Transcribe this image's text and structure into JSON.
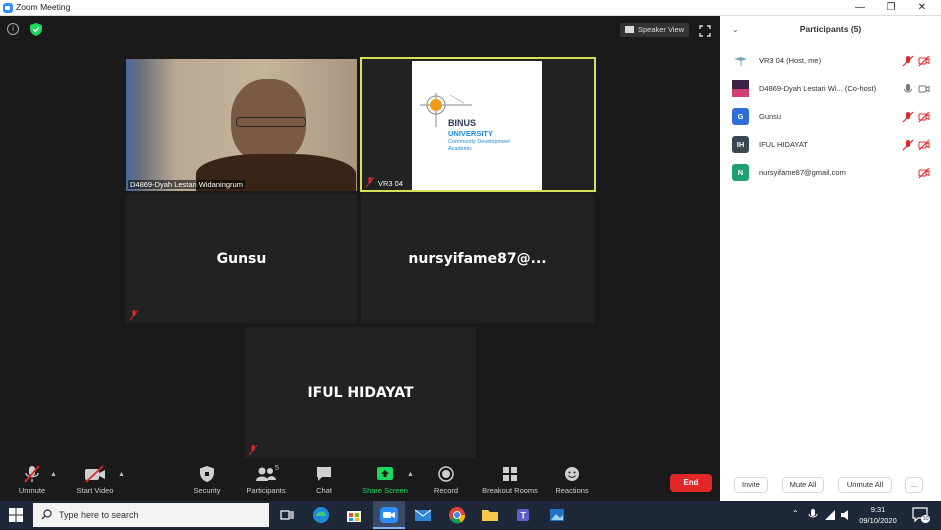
{
  "window": {
    "title": "Zoom Meeting"
  },
  "meeting": {
    "view_label": "Speaker View",
    "tiles": [
      {
        "name_label": "D4869-Dyah Lestari Widaningrum"
      },
      {
        "name_label": "VR3 04",
        "slide": {
          "line1": "BINUS",
          "line2": "UNIVERSITY",
          "line3": "Community Developmeet",
          "line4": "Academic"
        }
      },
      {
        "big_name": "Gunsu"
      },
      {
        "big_name": "nursyifame87@..."
      },
      {
        "big_name": "IFUL HIDAYAT"
      }
    ]
  },
  "toolbar": {
    "unmute": "Unmute",
    "start_video": "Start Video",
    "security": "Security",
    "participants": "Participants",
    "participants_count": "5",
    "chat": "Chat",
    "share_screen": "Share Screen",
    "record": "Record",
    "breakout_rooms": "Breakout Rooms",
    "reactions": "Reactions",
    "end": "End"
  },
  "panel": {
    "title": "Participants (5)",
    "participants": [
      {
        "name": "VR3 04 (Host, me)",
        "initials": "",
        "color": "#ffffff"
      },
      {
        "name": "D4869-Dyah Lestari Wi...  (Co-host)",
        "initials": "",
        "color": "#4a2a55"
      },
      {
        "name": "Gunsu",
        "initials": "G",
        "color": "#2d6fd6"
      },
      {
        "name": "IFUL HIDAYAT",
        "initials": "IH",
        "color": "#3a4650"
      },
      {
        "name": "nursyifame87@gmail.com",
        "initials": "N",
        "color": "#1fa074"
      }
    ],
    "invite": "Invite",
    "mute_all": "Mute All",
    "unmute_all": "Unmute All",
    "more": "..."
  },
  "taskbar": {
    "search_placeholder": "Type here to search",
    "time": "9:31",
    "date": "09/10/2020",
    "notif_count": "10"
  },
  "colors": {
    "accent_green": "#1ed760",
    "highlight_border": "#d4e157",
    "end_red": "#e02828",
    "zoom_blue": "#2d8cff"
  }
}
